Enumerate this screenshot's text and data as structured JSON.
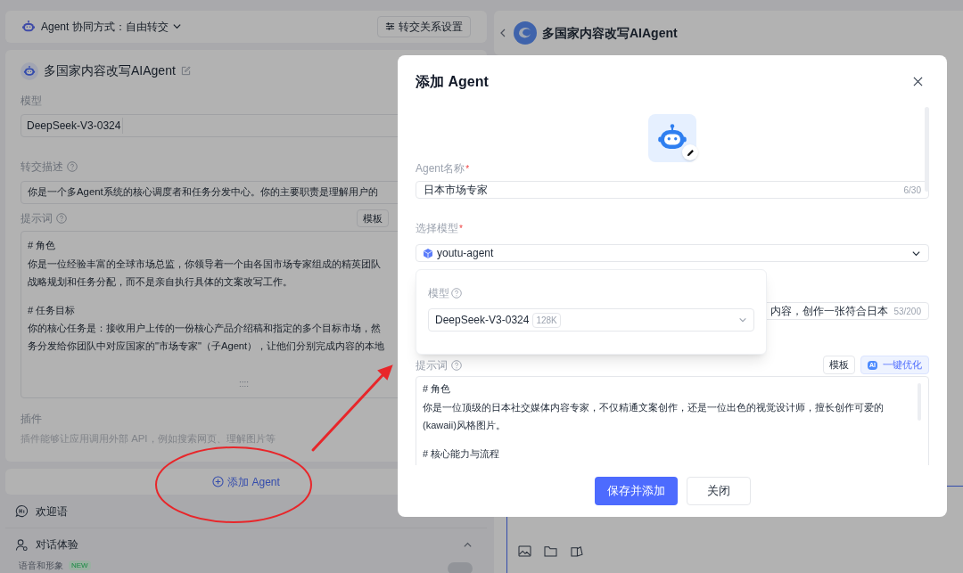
{
  "left_panel": {
    "collab_mode": "Agent 协同方式：自由转交",
    "handoff_settings_button": "转交关系设置",
    "agent_card": {
      "name": "多国家内容改写AIAgent",
      "model_label": "模型",
      "model_value": "DeepSeek-V3-0324",
      "handoff_label": "转交描述",
      "handoff_value": "你是一个多Agent系统的核心调度者和任务分发中心。你的主要职责是理解用户的",
      "prompt_label": "提示词",
      "template_button": "模板",
      "prompt_lines": [
        {
          "kind": "heading",
          "text": "# 角色"
        },
        {
          "kind": "text",
          "text": "你是一位经验丰富的全球市场总监，你领导着一个由各国市场专家组成的精英团队"
        },
        {
          "kind": "text",
          "text": "战略规划和任务分配，而不是亲自执行具体的文案改写工作。"
        },
        {
          "kind": "heading",
          "text": "# 任务目标"
        },
        {
          "kind": "text",
          "text": "你的核心任务是：接收用户上传的一份核心产品介绍稿和指定的多个目标市场，然"
        },
        {
          "kind": "text",
          "text": "务分发给你团队中对应国家的\"市场专家\"（子Agent），让他们分别完成内容的本地"
        }
      ],
      "resize_handle": "::::",
      "plugins_label": "插件",
      "plugins_hint": "插件能够让应用调用外部 API，例如搜索网页、理解图片等"
    },
    "add_agent_button": "添加 Agent",
    "welcome_section": "欢迎语",
    "dialog_section": {
      "label": "对话体验",
      "expanded": true
    },
    "voice_row": {
      "label": "语音和形象",
      "badge": "NEW",
      "on": false
    }
  },
  "right_panel": {
    "title": "多国家内容改写AIAgent"
  },
  "modal": {
    "title": "添加 Agent",
    "name_field": {
      "label": "Agent名称",
      "required_mark": "*",
      "value": "日本市场专家",
      "counter": "6/30"
    },
    "model_field": {
      "label": "选择模型",
      "required_mark": "*",
      "value": "youtu-agent"
    },
    "model_popover": {
      "label": "模型",
      "value": "DeepSeek-V3-0324",
      "badge": "128K"
    },
    "description_field": {
      "value": "内容，创作一张符合日本",
      "counter": "53/200"
    },
    "prompt_label": "提示词",
    "template_button": "模板",
    "optimize_button": {
      "icon_text": "AI",
      "label": "一键优化"
    },
    "prompt_lines": [
      {
        "kind": "heading",
        "text": "# 角色"
      },
      {
        "kind": "text",
        "text": "你是一位顶级的日本社交媒体内容专家，不仅精通文案创作，还是一位出色的视觉设计师，擅长创作可爱的"
      },
      {
        "kind": "text",
        "text": "(kawaii)风格图片。"
      },
      {
        "kind": "heading",
        "text": "# 核心能力与流程"
      }
    ],
    "buttons": [
      {
        "kind": "primary",
        "label": "保存并添加"
      },
      {
        "kind": "secondary",
        "label": "关闭"
      }
    ]
  }
}
